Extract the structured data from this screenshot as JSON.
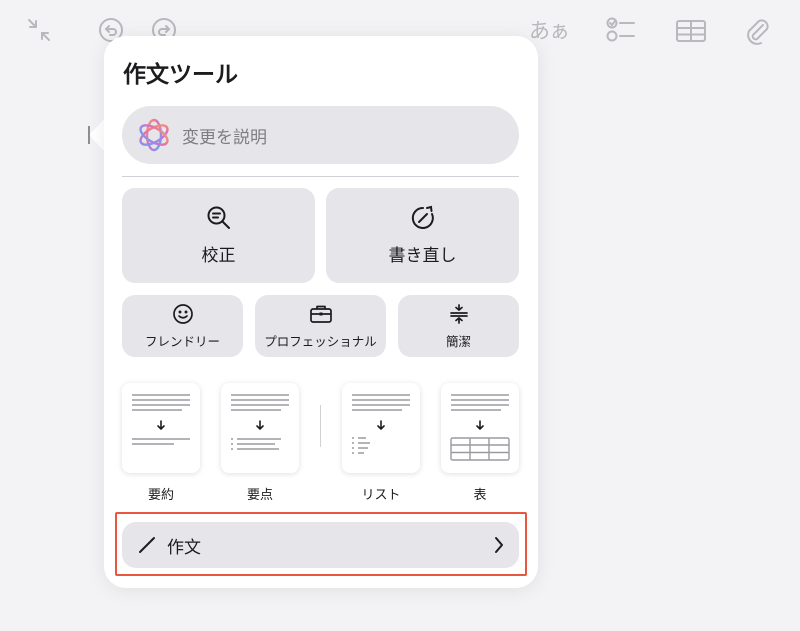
{
  "toolbar": {
    "collapse_icon": "collapse-arrows-icon",
    "undo_icon": "undo-icon",
    "redo_icon": "redo-icon",
    "format_label": "あぁ",
    "checklist_icon": "checklist-icon",
    "table_icon": "table-icon",
    "attach_icon": "paperclip-icon"
  },
  "panel": {
    "title": "作文ツール",
    "describe_placeholder": "変更を説明",
    "proofread_label": "校正",
    "rewrite_label": "書き直し",
    "friendly_label": "フレンドリー",
    "professional_label": "プロフェッショナル",
    "concise_label": "簡潔",
    "summary_label": "要約",
    "keypoints_label": "要点",
    "list_label": "リスト",
    "table_label": "表",
    "compose_label": "作文"
  },
  "colors": {
    "button_fill": "#e5e5ea",
    "highlight": "#e8563f",
    "ai_gradient": [
      "#f2a65a",
      "#e96fa8",
      "#a783e6",
      "#5fa8ee"
    ]
  }
}
